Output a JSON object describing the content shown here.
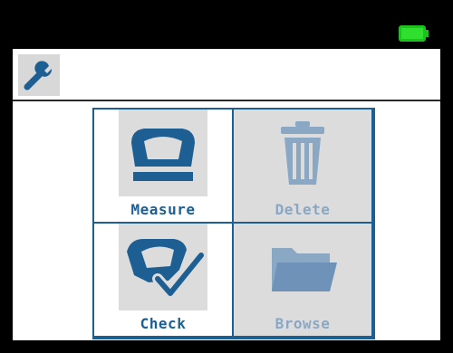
{
  "status_bar": {
    "battery_icon": "battery-full-icon",
    "battery_color": "#1ec21e"
  },
  "toolbar": {
    "settings_icon": "wrench-icon"
  },
  "menu": {
    "accent_color": "#1d5f93",
    "disabled_color": "#8aa7c4",
    "tiles": [
      {
        "label": "Measure",
        "icon": "measure-icon",
        "enabled": true
      },
      {
        "label": "Delete",
        "icon": "trash-icon",
        "enabled": false
      },
      {
        "label": "Check",
        "icon": "check-icon",
        "enabled": true
      },
      {
        "label": "Browse",
        "icon": "folder-icon",
        "enabled": false
      }
    ]
  }
}
